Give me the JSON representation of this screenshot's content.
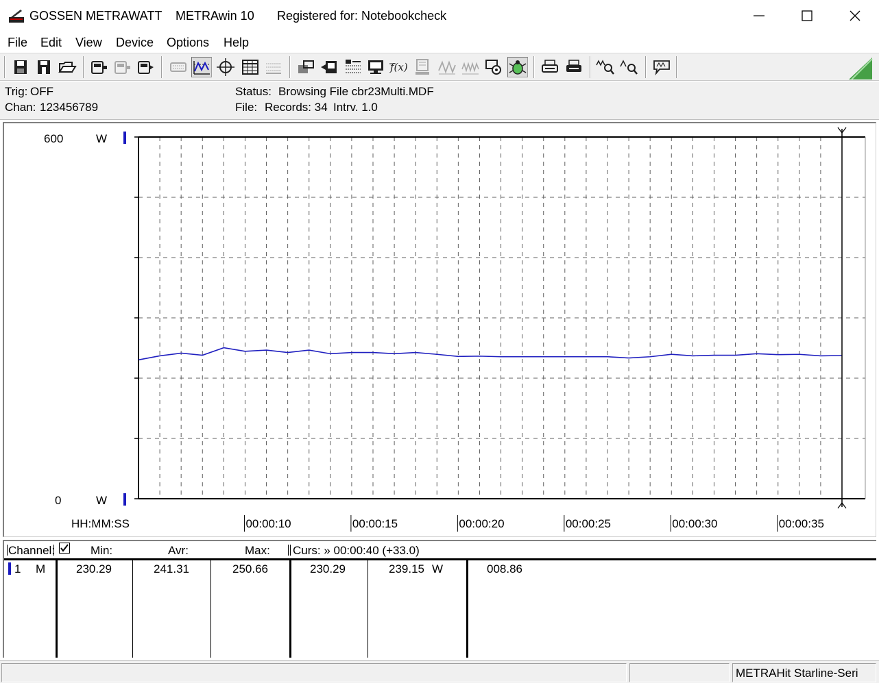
{
  "window": {
    "brand": "GOSSEN METRAWATT",
    "app": "METRAwin 10",
    "registered": "Registered for: Notebookcheck"
  },
  "menu": [
    "File",
    "Edit",
    "View",
    "Device",
    "Options",
    "Help"
  ],
  "toolbar_icons": [
    "save-icon",
    "save-as-icon",
    "open-folder-icon",
    "device-read-icon",
    "device-disabled-icon",
    "device-write-icon",
    "keyboard-disabled-icon",
    "waveform-icon",
    "crosshair-icon",
    "table-icon",
    "grid-disabled-icon",
    "export-icon",
    "record-icon",
    "list-icon",
    "monitor-icon",
    "formula-icon",
    "memory-disabled-icon",
    "wave-disabled-icon",
    "wave2-disabled-icon",
    "settings-icon",
    "bug-icon",
    "print-preview-icon",
    "print-icon",
    "zoom-in-icon",
    "zoom-out-icon",
    "comment-icon"
  ],
  "info": {
    "trig_label": "Trig:",
    "trig_value": "OFF",
    "chan_label": "Chan:",
    "chan_value": "123456789",
    "status_label": "Status:",
    "status_value": "Browsing File cbr23Multi.MDF",
    "file_label": "File:",
    "records": "Records: 34",
    "interval": "Intrv. 1.0"
  },
  "chart": {
    "y_top_label": "600",
    "y_bottom_label": "0",
    "y_unit": "W",
    "x_axis_label": "HH:MM:SS"
  },
  "chart_data": {
    "type": "line",
    "ylim": [
      0,
      600
    ],
    "xlim": [
      5,
      38
    ],
    "x_tick_labels": [
      "00:00:10",
      "00:00:15",
      "00:00:20",
      "00:00:25",
      "00:00:30",
      "00:00:35"
    ],
    "x_tick_values": [
      10,
      15,
      20,
      25,
      30,
      35
    ],
    "ylabel": "W",
    "xlabel": "HH:MM:SS",
    "grid": true,
    "series": [
      {
        "color": "#2020c0",
        "x": [
          5,
          6,
          7,
          8,
          9,
          10,
          11,
          12,
          13,
          14,
          15,
          16,
          17,
          18,
          19,
          20,
          21,
          22,
          23,
          24,
          25,
          26,
          27,
          28,
          29,
          30,
          31,
          32,
          33,
          34,
          35,
          36,
          37,
          38
        ],
        "values": [
          230.3,
          237,
          241.5,
          238,
          250.5,
          244.5,
          246.5,
          242.5,
          246.5,
          240.5,
          242.5,
          242.5,
          240.5,
          242.5,
          239.5,
          236,
          236.5,
          235.5,
          235.5,
          235.5,
          235.5,
          235.5,
          235.5,
          233.5,
          235.5,
          239.5,
          237,
          238,
          238,
          240.5,
          239,
          239.5,
          237,
          237.5
        ]
      }
    ]
  },
  "table": {
    "headers": {
      "channel": "Channel:",
      "min": "Min:",
      "avr": "Avr:",
      "max": "Max:",
      "curs": "Curs: » 00:00:40 (+33.0)"
    },
    "row": {
      "num": "1",
      "type": "M",
      "min": "230.29",
      "avr": "241.31",
      "max": "250.66",
      "curs_val": "230.29",
      "value": "239.15",
      "unit": "W",
      "extra": "008.86"
    }
  },
  "status": {
    "device": "METRAHit Starline-Seri"
  }
}
